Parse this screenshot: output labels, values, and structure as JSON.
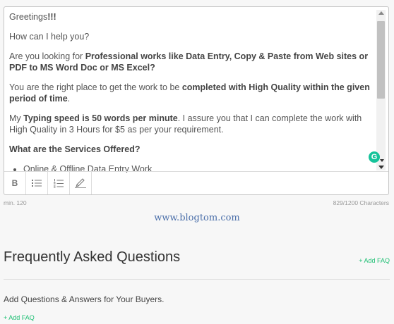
{
  "editor": {
    "greeting_prefix": "Greetings",
    "greeting_bang": "!!!",
    "help_line": "How can I help you?",
    "p3_prefix": "Are you looking for ",
    "p3_bold": "Professional works like Data Entry, Copy & Paste from Web sites or PDF to MS Word Doc or MS Excel?",
    "p4_prefix": "You are the right place to get the work to be ",
    "p4_bold": "completed with High Quality within the given period of time",
    "p4_suffix": ".",
    "p5_prefix": "My ",
    "p5_bold": "Typing speed is 50 words per minute",
    "p5_suffix": ". I assure you that I can complete the work with High Quality in 3 Hours for $5 as per your requirement.",
    "services_heading": "What are the Services Offered?",
    "services": [
      "Online & Offline Data Entry Work"
    ],
    "grammarly_letter": "G"
  },
  "toolbar": {
    "bold_label": "B",
    "icons": [
      "bold-icon",
      "bulleted-list-icon",
      "numbered-list-icon",
      "highlighter-icon"
    ]
  },
  "meta": {
    "min_label": "min. 120",
    "char_count": "829/1200 Characters"
  },
  "watermark": "www.blogtom.com",
  "faq": {
    "title": "Frequently Asked Questions",
    "add_label_top": "+ Add FAQ",
    "description": "Add Questions & Answers for Your Buyers.",
    "add_label_bottom": "+ Add FAQ"
  },
  "colors": {
    "accent_green": "#1dbf73",
    "grammarly_green": "#15c39a",
    "watermark_blue": "#4a6ea9"
  }
}
